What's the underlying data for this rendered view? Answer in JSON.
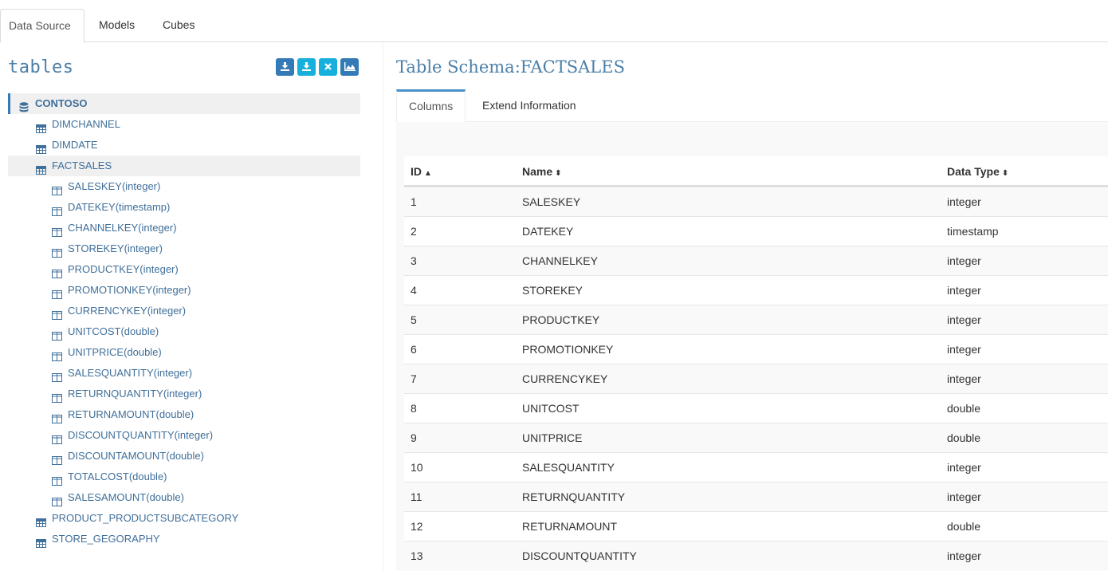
{
  "top_tabs": [
    "Data Source",
    "Models",
    "Cubes"
  ],
  "left": {
    "title": "tables",
    "buttons": [
      "download-icon",
      "download-icon",
      "close-icon",
      "area-chart-icon"
    ]
  },
  "tree": {
    "root": "CONTOSO",
    "tables": [
      "DIMCHANNEL",
      "DIMDATE",
      "FACTSALES"
    ],
    "columns": [
      {
        "name": "SALESKEY",
        "type": "(integer)"
      },
      {
        "name": "DATEKEY",
        "type": "(timestamp)"
      },
      {
        "name": "CHANNELKEY",
        "type": "(integer)"
      },
      {
        "name": "STOREKEY",
        "type": "(integer)"
      },
      {
        "name": "PRODUCTKEY",
        "type": "(integer)"
      },
      {
        "name": "PROMOTIONKEY",
        "type": "(integer)"
      },
      {
        "name": "CURRENCYKEY",
        "type": "(integer)"
      },
      {
        "name": "UNITCOST",
        "type": "(double)"
      },
      {
        "name": "UNITPRICE",
        "type": "(double)"
      },
      {
        "name": "SALESQUANTITY",
        "type": "(integer)"
      },
      {
        "name": "RETURNQUANTITY",
        "type": "(integer)"
      },
      {
        "name": "RETURNAMOUNT",
        "type": "(double)"
      },
      {
        "name": "DISCOUNTQUANTITY",
        "type": "(integer)"
      },
      {
        "name": "DISCOUNTAMOUNT",
        "type": "(double)"
      },
      {
        "name": "TOTALCOST",
        "type": "(double)"
      },
      {
        "name": "SALESAMOUNT",
        "type": "(double)"
      }
    ],
    "more_tables": [
      "PRODUCT_PRODUCTSUBCATEGORY",
      "STORE_GEGORAPHY"
    ]
  },
  "right": {
    "title": "Table Schema:FACTSALES",
    "tabs": [
      "Columns",
      "Extend Information"
    ]
  },
  "table": {
    "headers": [
      "ID",
      "Name",
      "Data Type"
    ],
    "rows": [
      [
        "1",
        "SALESKEY",
        "integer"
      ],
      [
        "2",
        "DATEKEY",
        "timestamp"
      ],
      [
        "3",
        "CHANNELKEY",
        "integer"
      ],
      [
        "4",
        "STOREKEY",
        "integer"
      ],
      [
        "5",
        "PRODUCTKEY",
        "integer"
      ],
      [
        "6",
        "PROMOTIONKEY",
        "integer"
      ],
      [
        "7",
        "CURRENCYKEY",
        "integer"
      ],
      [
        "8",
        "UNITCOST",
        "double"
      ],
      [
        "9",
        "UNITPRICE",
        "double"
      ],
      [
        "10",
        "SALESQUANTITY",
        "integer"
      ],
      [
        "11",
        "RETURNQUANTITY",
        "integer"
      ],
      [
        "12",
        "RETURNAMOUNT",
        "double"
      ],
      [
        "13",
        "DISCOUNTQUANTITY",
        "integer"
      ]
    ]
  },
  "colors": {
    "link": "#3f6f9a",
    "accent": "#337ab7",
    "cyan": "#17b0dc",
    "title": "#4a7fa8"
  }
}
